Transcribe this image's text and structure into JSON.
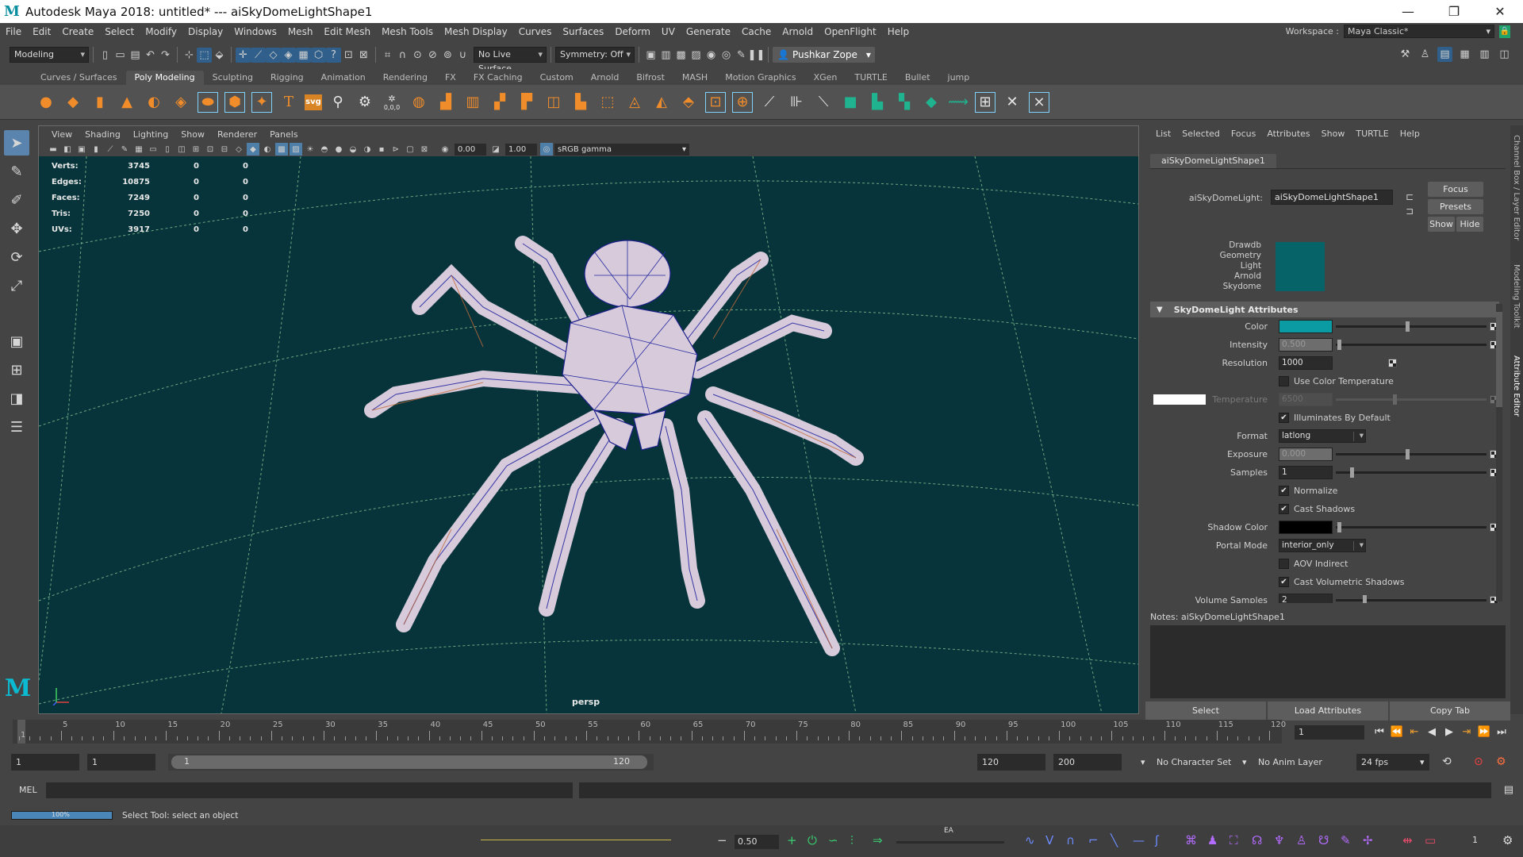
{
  "window": {
    "title": "Autodesk Maya 2018: untitled*   ---   aiSkyDomeLightShape1",
    "controls": [
      "—",
      "❐",
      "✕"
    ]
  },
  "menubar": {
    "items": [
      "File",
      "Edit",
      "Create",
      "Select",
      "Modify",
      "Display",
      "Windows",
      "Mesh",
      "Edit Mesh",
      "Mesh Tools",
      "Mesh Display",
      "Curves",
      "Surfaces",
      "Deform",
      "UV",
      "Generate",
      "Cache",
      "Arnold",
      "OpenFlight",
      "Help"
    ],
    "workspace_label": "Workspace :",
    "workspace_value": "Maya Classic*"
  },
  "statusline": {
    "mode": "Modeling",
    "live_surface": "No Live Surface",
    "symmetry": "Symmetry: Off",
    "user": "Pushkar Zope"
  },
  "shelf": {
    "tabs": [
      "Curves / Surfaces",
      "Poly Modeling",
      "Sculpting",
      "Rigging",
      "Animation",
      "Rendering",
      "FX",
      "FX Caching",
      "Custom",
      "Arnold",
      "Bifrost",
      "MASH",
      "Motion Graphics",
      "XGen",
      "TURTLE",
      "Bullet",
      "jump"
    ],
    "active_tab": "Poly Modeling",
    "svg_label": "svg",
    "num_label": "0,0,0"
  },
  "viewport": {
    "menu": [
      "View",
      "Shading",
      "Lighting",
      "Show",
      "Renderer",
      "Panels"
    ],
    "exposure": "0.00",
    "gamma": "1.00",
    "color_space": "sRGB gamma",
    "camera_label": "persp",
    "hud": [
      {
        "label": "Verts:",
        "v1": "3745",
        "v2": "0",
        "v3": "0"
      },
      {
        "label": "Edges:",
        "v1": "10875",
        "v2": "0",
        "v3": "0"
      },
      {
        "label": "Faces:",
        "v1": "7249",
        "v2": "0",
        "v3": "0"
      },
      {
        "label": "Tris:",
        "v1": "7250",
        "v2": "0",
        "v3": "0"
      },
      {
        "label": "UVs:",
        "v1": "3917",
        "v2": "0",
        "v3": "0"
      }
    ],
    "background_color": "#06343a"
  },
  "attribute_editor": {
    "menu": [
      "List",
      "Selected",
      "Focus",
      "Attributes",
      "Show",
      "TURTLE",
      "Help"
    ],
    "tab": "aiSkyDomeLightShape1",
    "node_label": "aiSkyDomeLight:",
    "node_name": "aiSkyDomeLightShape1",
    "focus_btn": "Focus",
    "presets_btn": "Presets",
    "show_btn": "Show",
    "hide_btn": "Hide",
    "swatch_lines": [
      "Drawdb",
      "Geometry",
      "Light",
      "Arnold",
      "Skydome"
    ],
    "section_title": "SkyDomeLight Attributes",
    "color_label": "Color",
    "color_value": "#0b9ca3",
    "intensity_label": "Intensity",
    "intensity_value": "0.500",
    "resolution_label": "Resolution",
    "resolution_value": "1000",
    "use_color_temp": "Use Color Temperature",
    "temperature_label": "Temperature",
    "temperature_value": "6500",
    "illuminates": "Illuminates By Default",
    "format_label": "Format",
    "format_value": "latlong",
    "exposure_label": "Exposure",
    "exposure_value": "0.000",
    "samples_label": "Samples",
    "samples_value": "1",
    "normalize": "Normalize",
    "cast_shadows": "Cast Shadows",
    "shadow_color_label": "Shadow Color",
    "portal_mode_label": "Portal Mode",
    "portal_mode_value": "interior_only",
    "aov_indirect": "AOV Indirect",
    "cast_vol_shadows": "Cast Volumetric Shadows",
    "volume_samples_label": "Volume Samples",
    "volume_samples_value": "2",
    "notes_label": "Notes:  aiSkyDomeLightShape1",
    "btn_select": "Select",
    "btn_load": "Load Attributes",
    "btn_copy": "Copy Tab",
    "side_tabs": [
      "Channel Box / Layer Editor",
      "Modeling Toolkit",
      "Attribute Editor"
    ]
  },
  "timeline": {
    "ticks": [
      "5",
      "10",
      "15",
      "20",
      "25",
      "30",
      "35",
      "40",
      "45",
      "50",
      "55",
      "60",
      "65",
      "70",
      "75",
      "80",
      "85",
      "90",
      "95",
      "100",
      "105",
      "110",
      "115",
      "120"
    ],
    "start_tick": "1",
    "current_frame": "1"
  },
  "range": {
    "start": "1",
    "anim_start": "1",
    "range_start": "1",
    "range_end": "120",
    "anim_end": "120",
    "end": "200",
    "character_set": "No Character Set",
    "anim_layer": "No Anim Layer",
    "fps": "24 fps"
  },
  "command_line": {
    "lang": "MEL"
  },
  "help_line": {
    "progress_text": "100%",
    "progress_fraction": 1.0,
    "message": "Select Tool: select an object"
  },
  "bottom_strip": {
    "zoom_value": "0.50",
    "ea_label": "EA",
    "count": "1"
  }
}
